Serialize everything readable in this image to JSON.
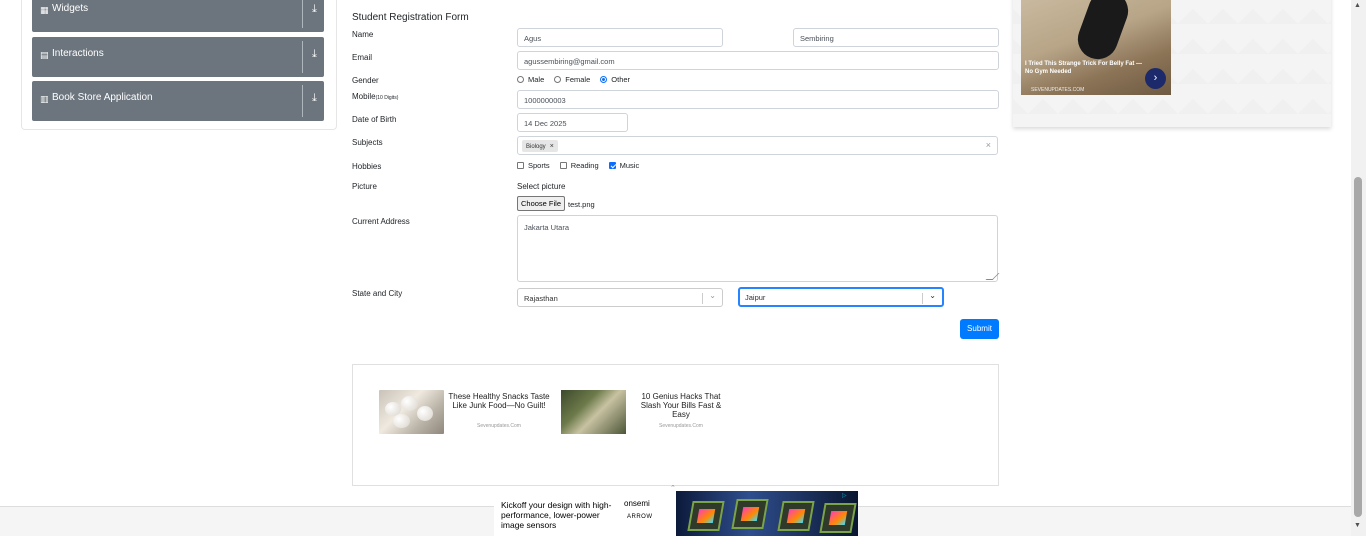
{
  "sidebar": {
    "groups": [
      {
        "label": "Widgets",
        "icon": "grid-icon"
      },
      {
        "label": "Interactions",
        "icon": "list-icon"
      },
      {
        "label": "Book Store Application",
        "icon": "book-icon"
      }
    ]
  },
  "form": {
    "title": "Student Registration Form",
    "name_label": "Name",
    "first_name": "Agus",
    "last_name": "Sembiring",
    "email_label": "Email",
    "email": "agussembiring@gmail.com",
    "gender_label": "Gender",
    "gender_options": [
      "Male",
      "Female",
      "Other"
    ],
    "gender_selected": "Other",
    "mobile_label": "Mobile",
    "mobile_hint": "(10 Digits)",
    "mobile": "1000000003",
    "dob_label": "Date of Birth",
    "dob": "14 Dec 2025",
    "subjects_label": "Subjects",
    "subjects": [
      "Biology"
    ],
    "subjects_clear": "×",
    "chip_remove": "×",
    "hobbies_label": "Hobbies",
    "hobbies": [
      {
        "label": "Sports",
        "checked": false
      },
      {
        "label": "Reading",
        "checked": false
      },
      {
        "label": "Music",
        "checked": true
      }
    ],
    "picture_label": "Picture",
    "picture_prompt": "Select picture",
    "choose_file_label": "Choose File",
    "file_name": "test.png",
    "address_label": "Current Address",
    "address": "Jakarta Utara",
    "state_city_label": "State and City",
    "state": "Rajasthan",
    "city": "Jaipur",
    "submit_label": "Submit"
  },
  "ads": {
    "card1_text": "These Healthy Snacks Taste Like Junk Food—No Guilt!",
    "card1_source": "Sevenupdates.Com",
    "card2_text": "10 Genius Hacks That Slash Your Bills Fast & Easy",
    "card2_source": "Sevenupdates.Com",
    "top_right_caption": "I Tried This Strange Trick For Belly Fat — No Gym Needed",
    "top_right_source": "SEVENUPDATES.COM",
    "bottom_text": "Kickoff your design with high-performance, lower-power image sensors",
    "bottom_logo1": "onsemi",
    "bottom_logo2": "ARROW"
  },
  "colors": {
    "accent": "#007bff",
    "sidebar_group": "#6c757d",
    "focus_border": "#2684ff"
  }
}
